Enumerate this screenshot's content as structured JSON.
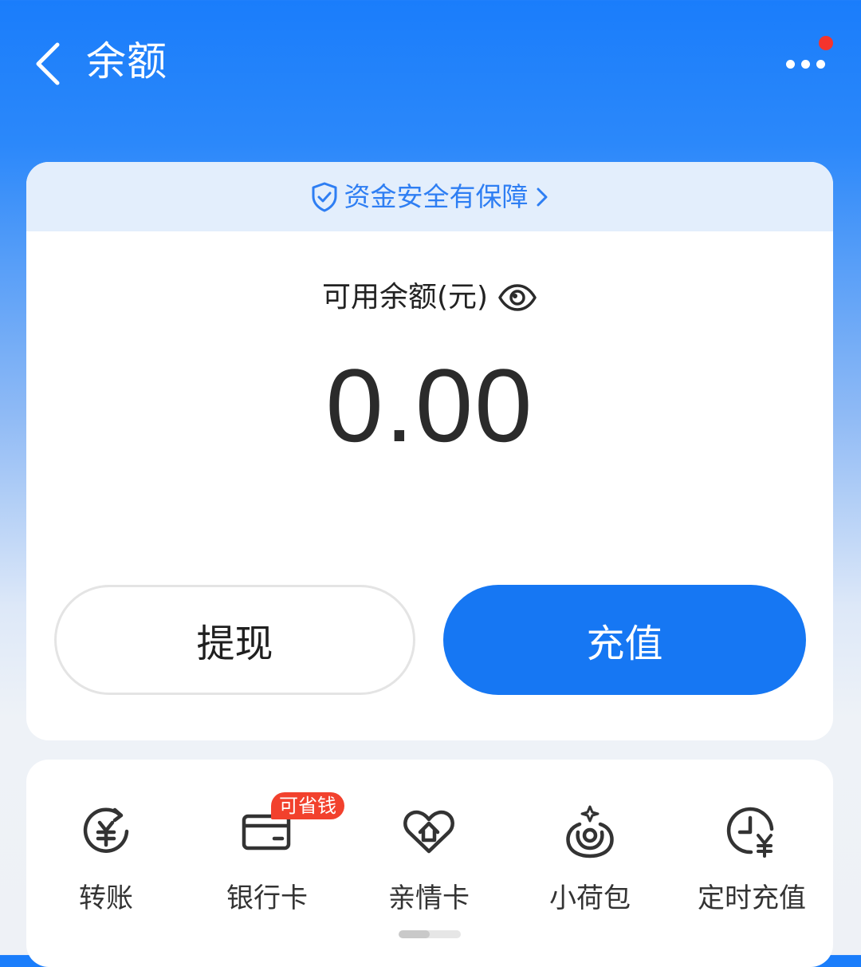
{
  "header": {
    "title": "余额"
  },
  "security_bar": {
    "text": "资金安全有保障"
  },
  "balance": {
    "label": "可用余额(元)",
    "amount": "0.00"
  },
  "actions": {
    "withdraw_label": "提现",
    "recharge_label": "充值"
  },
  "shortcuts": {
    "items": [
      {
        "label": "转账",
        "icon": "transfer-yuan-icon"
      },
      {
        "label": "银行卡",
        "icon": "bank-card-icon",
        "badge": "可省钱"
      },
      {
        "label": "亲情卡",
        "icon": "family-card-heart-icon"
      },
      {
        "label": "小荷包",
        "icon": "small-pouch-icon"
      },
      {
        "label": "定时充值",
        "icon": "scheduled-recharge-clock-icon"
      }
    ]
  },
  "colors": {
    "header_blue": "#1a7dfb",
    "primary_button": "#1677f3",
    "security_text": "#2e7ef3",
    "badge_red": "#f2412d",
    "notification_dot": "#f5342c"
  }
}
